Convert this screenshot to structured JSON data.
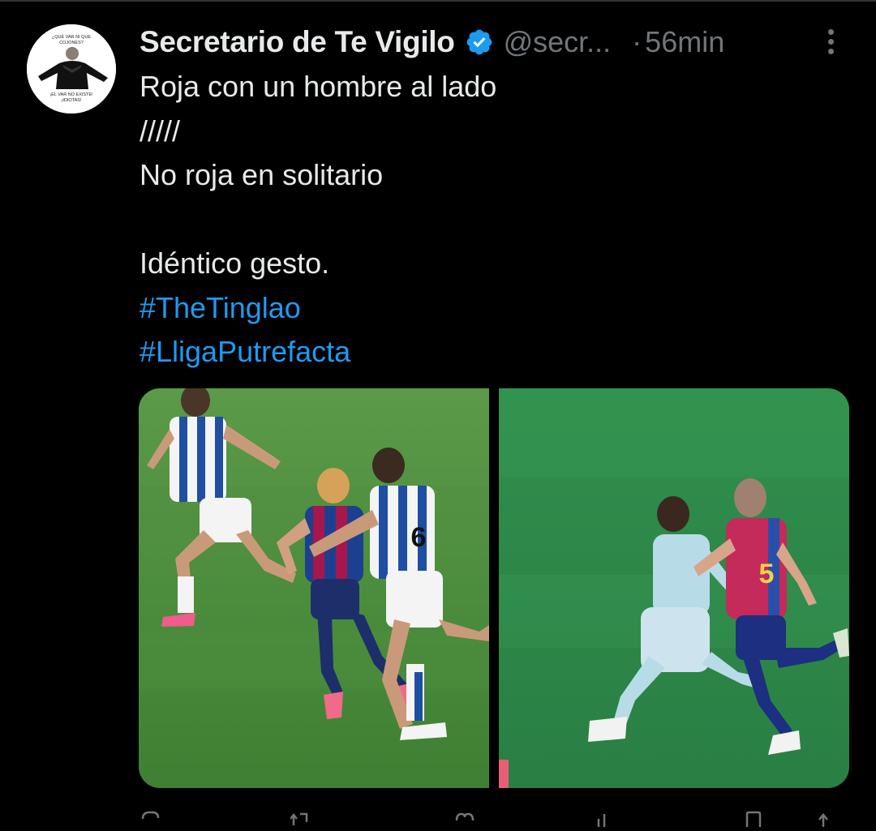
{
  "tweet": {
    "author_name": "Secretario de Te Vigilo",
    "handle": "@secr...",
    "separator": "·",
    "time": "56min",
    "avatar": {
      "top_text_1": "¿QUÉ VAR NI QUE",
      "top_text_2": "COJONES?",
      "bottom_text_1": "¡EL VAR NO EXISTE!",
      "bottom_text_2": "¡IDIOTAS!"
    },
    "lines": [
      "Roja con un hombre al lado",
      "/////",
      "No roja en solitario",
      "",
      "Idéntico gesto."
    ],
    "hashtags": [
      "#TheTinglao",
      "#LligaPutrefacta"
    ],
    "media": [
      {
        "jersey_number": "6"
      },
      {
        "jersey_number": "5"
      }
    ]
  },
  "colors": {
    "background": "#000000",
    "text": "#e7e9ea",
    "secondary": "#71767b",
    "accent": "#1d9bf0",
    "pitch": "#3f8a3a"
  },
  "icons": {
    "verified": "verified-badge-icon",
    "more": "more-dots-icon",
    "reply": "reply-icon",
    "retweet": "retweet-icon",
    "like": "like-icon",
    "views": "views-icon",
    "bookmark": "bookmark-icon",
    "share": "share-icon"
  }
}
